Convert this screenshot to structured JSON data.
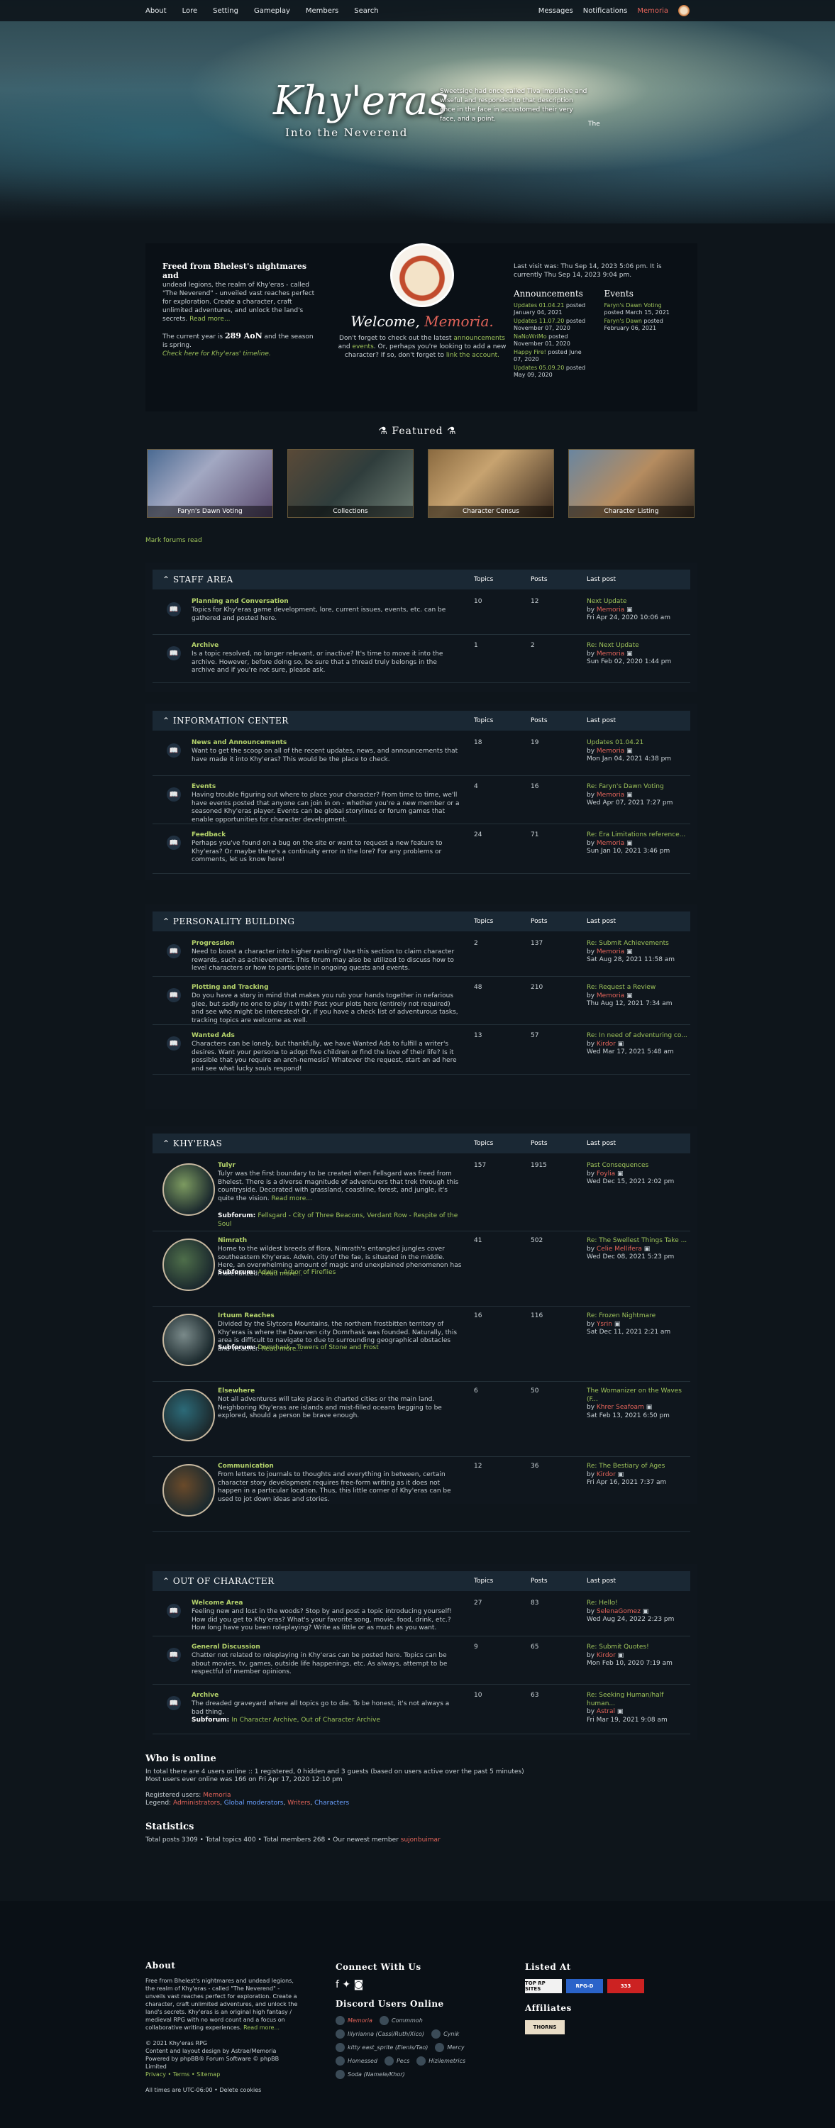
{
  "nav": {
    "about": "About",
    "lore": "Lore",
    "setting": "Setting",
    "gameplay": "Gameplay",
    "members": "Members",
    "search": "Search",
    "messages": "Messages",
    "notifications": "Notifications",
    "user": "Memoria"
  },
  "hero": {
    "title": "Khy'eras",
    "subtitle": "Into the Neverend",
    "quote": "Sweetsige had once called Tiva impulsive and wiseful and responded to that description once in the face in accustomed their very face, and a point.",
    "quote_author": "The"
  },
  "intro": {
    "left_head": "Freed from Bhelest's nightmares and",
    "left_body": "undead legions, the realm of Khy'eras - called \"The Neverend\" - unveiled vast reaches perfect for exploration. Create a character, craft unlimited adventures, and unlock the land's secrets.",
    "read_more": "Read more...",
    "year_text": "The current year is",
    "year": "289 AoN",
    "season": "and the season is spring.",
    "timeline": "Check here for Khy'eras' timeline.",
    "welcome": "Welcome,",
    "welcome_name": "Memoria.",
    "mid_text1": "Don't forget to check out the latest",
    "announcements": "announcements",
    "and": "and",
    "events": "events",
    "mid_text2": ". Or, perhaps you're looking to add a new character? If so, don't forget to",
    "link": "link the account.",
    "last_visit": "Last visit was: Thu Sep 14, 2023 5:06 pm. It is currently Thu Sep 14, 2023 9:04 pm.",
    "ann_h": "Announcements",
    "ev_h": "Events",
    "ann": [
      [
        "Updates 01.04.21",
        "posted January 04, 2021"
      ],
      [
        "Updates 11.07.20",
        "posted November 07, 2020"
      ],
      [
        "NaNoWriMo",
        "posted November 01, 2020"
      ],
      [
        "Happy Fire!",
        "posted June 07, 2020"
      ],
      [
        "Updates 05.09.20",
        "posted May 09, 2020"
      ]
    ],
    "ev": [
      [
        "Faryn's Dawn Voting",
        "posted March 15, 2021"
      ],
      [
        "Faryn's Dawn",
        "posted February 06, 2021"
      ]
    ]
  },
  "featured": {
    "heading": "Featured",
    "cards": [
      "Faryn's Dawn Voting",
      "Collections",
      "Character Census",
      "Character Listing"
    ]
  },
  "mark_read": "Mark forums read",
  "cols": {
    "topics": "Topics",
    "posts": "Posts",
    "last": "Last post"
  },
  "sections": [
    {
      "name": "Staff Area",
      "rows": [
        {
          "t": "Planning and Conversation",
          "d": "Topics for Khy'eras game development, lore, current issues, events, etc. can be gathered and posted here.",
          "n1": "10",
          "n2": "12",
          "lt": "Next Update",
          "by": "Memoria",
          "dt": "Fri Apr 24, 2020 10:06 am"
        },
        {
          "t": "Archive",
          "d": "Is a topic resolved, no longer relevant, or inactive? It's time to move it into the archive. However, before doing so, be sure that a thread truly belongs in the archive and if you're not sure, please ask.",
          "n1": "1",
          "n2": "2",
          "lt": "Re: Next Update",
          "by": "Memoria",
          "dt": "Sun Feb 02, 2020 1:44 pm"
        }
      ]
    },
    {
      "name": "Information Center",
      "rows": [
        {
          "t": "News and Announcements",
          "d": "Want to get the scoop on all of the recent updates, news, and announcements that have made it into Khy'eras? This would be the place to check.",
          "n1": "18",
          "n2": "19",
          "lt": "Updates 01.04.21",
          "by": "Memoria",
          "dt": "Mon Jan 04, 2021 4:38 pm"
        },
        {
          "t": "Events",
          "d": "Having trouble figuring out where to place your character? From time to time, we'll have events posted that anyone can join in on - whether you're a new member or a seasoned Khy'eras player. Events can be global storylines or forum games that enable opportunities for character development.",
          "n1": "4",
          "n2": "16",
          "lt": "Re: Faryn's Dawn Voting",
          "by": "Memoria",
          "dt": "Wed Apr 07, 2021 7:27 pm"
        },
        {
          "t": "Feedback",
          "d": "Perhaps you've found on a bug on the site or want to request a new feature to Khy'eras? Or maybe there's a continuity error in the lore? For any problems or comments, let us know here!",
          "n1": "24",
          "n2": "71",
          "lt": "Re: Era Limitations reference...",
          "by": "Memoria",
          "dt": "Sun Jan 10, 2021 3:46 pm"
        }
      ]
    },
    {
      "name": "Personality Building",
      "rows": [
        {
          "t": "Progression",
          "d": "Need to boost a character into higher ranking? Use this section to claim character rewards, such as achievements. This forum may also be utilized to discuss how to level characters or how to participate in ongoing quests and events.",
          "n1": "2",
          "n2": "137",
          "lt": "Re: Submit Achievements",
          "by": "Memoria",
          "dt": "Sat Aug 28, 2021 11:58 am"
        },
        {
          "t": "Plotting and Tracking",
          "d": "Do you have a story in mind that makes you rub your hands together in nefarious glee, but sadly no one to play it with? Post your plots here (entirely not required) and see who might be interested! Or, if you have a check list of adventurous tasks, tracking topics are welcome as well.",
          "n1": "48",
          "n2": "210",
          "lt": "Re: Request a Review",
          "by": "Memoria",
          "dt": "Thu Aug 12, 2021 7:34 am"
        },
        {
          "t": "Wanted Ads",
          "d": "Characters can be lonely, but thankfully, we have Wanted Ads to fulfill a writer's desires. Want your persona to adopt five children or find the love of their life? Is it possible that you require an arch-nemesis? Whatever the request, start an ad here and see what lucky souls respond!",
          "n1": "13",
          "n2": "57",
          "lt": "Re: In need of adventuring co...",
          "by": "Kirdor",
          "dt": "Wed Mar 17, 2021 5:48 am"
        }
      ]
    },
    {
      "name": "Khy'eras",
      "rows": [
        {
          "t": "Tulyr",
          "d": "Tulyr was the first boundary to be created when Fellsgard was freed from Bhelest. There is a diverse magnitude of adventurers that trek through this countryside. Decorated with grassland, coastline, forest, and jungle, it's quite the vision.",
          "more": "Read more...",
          "subs": "Fellsgard - City of Three Beacons,  Verdant Row - Respite of the Soul",
          "n1": "157",
          "n2": "1915",
          "lt": "Past Consequences",
          "by": "Foylia",
          "dt": "Wed Dec 15, 2021 2:02 pm"
        },
        {
          "t": "Nimrath",
          "d": "Home to the wildest breeds of flora, Nimrath's entangled jungles cover southeastern Khy'eras. Adwin, city of the fae, is situated in the middle. Here, an overwhelming amount of magic and unexplained phenomenon has materialized.",
          "more": "Read more...",
          "subs": "Adwin - Arbor of Fireflies",
          "n1": "41",
          "n2": "502",
          "lt": "Re: The Swellest Things Take ...",
          "by": "Celie Mellifera",
          "dt": "Wed Dec 08, 2021 5:23 pm"
        },
        {
          "t": "Irtuum Reaches",
          "d": "Divided by the Slytcora Mountains, the northern frostbitten territory of Khy'eras is where the Dwarven city Domrhask was founded. Naturally, this area is difficult to navigate to due to surrounding geographical obstacles and weather.",
          "more": "Read more...",
          "subs": "Domrhask - Towers of Stone and Frost",
          "n1": "16",
          "n2": "116",
          "lt": "Re: Frozen Nightmare",
          "by": "Ysrin",
          "dt": "Sat Dec 11, 2021 2:21 am"
        },
        {
          "t": "Elsewhere",
          "d": "Not all adventures will take place in charted cities or the main land. Neighboring Khy'eras are islands and mist-filled oceans begging to be explored, should a person be brave enough.",
          "n1": "6",
          "n2": "50",
          "lt": "The Womanizer on the Waves (F...",
          "by": "Khrer Seafoam",
          "dt": "Sat Feb 13, 2021 6:50 pm"
        },
        {
          "t": "Communication",
          "d": "From letters to journals to thoughts and everything in between, certain character story development requires free-form writing as it does not happen in a particular location. Thus, this little corner of Khy'eras can be used to jot down ideas and stories.",
          "n1": "12",
          "n2": "36",
          "lt": "Re: The Bestiary of Ages",
          "by": "Kirdor",
          "dt": "Fri Apr 16, 2021 7:37 am"
        }
      ]
    },
    {
      "name": "Out of Character",
      "rows": [
        {
          "t": "Welcome Area",
          "d": "Feeling new and lost in the woods? Stop by and post a topic introducing yourself! How did you get to Khy'eras? What's your favorite song, movie, food, drink, etc.? How long have you been roleplaying? Write as little or as much as you want.",
          "n1": "27",
          "n2": "83",
          "lt": "Re: Hello!",
          "by": "SelenaGomez",
          "dt": "Wed Aug 24, 2022 2:23 pm"
        },
        {
          "t": "General Discussion",
          "d": "Chatter not related to roleplaying in Khy'eras can be posted here. Topics can be about movies, tv, games, outside life happenings, etc. As always, attempt to be respectful of member opinions.",
          "n1": "9",
          "n2": "65",
          "lt": "Re: Submit Quotes!",
          "by": "Kirdor",
          "dt": "Mon Feb 10, 2020 7:19 am"
        },
        {
          "t": "Archive",
          "d": "The dreaded graveyard where all topics go to die. To be honest, it's not always a bad thing.",
          "subs": "In Character Archive,  Out of Character Archive",
          "n1": "10",
          "n2": "63",
          "lt": "Re: Seeking Human/half human...",
          "by": "Astral",
          "dt": "Fri Mar 19, 2021 9:08 am"
        }
      ]
    }
  ],
  "who": {
    "h": "Who is online",
    "l1": "In total there are 4 users online :: 1 registered, 0 hidden and 3 guests (based on users active over the past 5 minutes)",
    "l2": "Most users ever online was 166 on Fri Apr 17, 2020 12:10 pm",
    "reg": "Registered users:",
    "reg_user": "Memoria",
    "legend": "Legend:",
    "adm": "Administrators",
    "gm": "Global moderators",
    "wr": "Writers",
    "ch": "Characters",
    "stats_h": "Statistics",
    "stats": "Total posts 3309 • Total topics 400 • Total members 268 • Our newest member",
    "newest": "sujonbuimar"
  },
  "footer": {
    "about_h": "About",
    "about": "Free from Bhelest's nightmares and undead legions, the realm of Khy'eras - called \"The Neverend\" - unveils vast reaches perfect for exploration. Create a character, craft unlimited adventures, and unlock the land's secrets. Khy'eras is an original high fantasy / medieval RPG with no word count and a focus on collaborative writing experiences.",
    "more": "Read more...",
    "c1": "© 2021 Khy'eras RPG",
    "c2": "Content and layout design by Astrae/Memoria",
    "c3": "Powered by phpBB® Forum Software © phpBB Limited",
    "c4": "Privacy  •  Terms  •  Sitemap",
    "tz": "All times are  UTC-06:00  •  Delete cookies",
    "connect_h": "Connect With Us",
    "discord_h": "Discord Users Online",
    "discord": [
      "Memoria",
      "Commmoh",
      "Illyrianna (Cassi/Ruth/Xico)",
      "Cynik",
      "kitty east_sprite (Elenis/Tao)",
      "Mercy",
      "Homessed",
      "Pecs",
      "Hizilemetrics",
      "Soda (Namele/Khor)"
    ],
    "listed_h": "Listed At",
    "listed": [
      "TOP RP SITES",
      "RPG-D",
      "333"
    ],
    "aff_h": "Affiliates",
    "aff": "THORNS"
  }
}
